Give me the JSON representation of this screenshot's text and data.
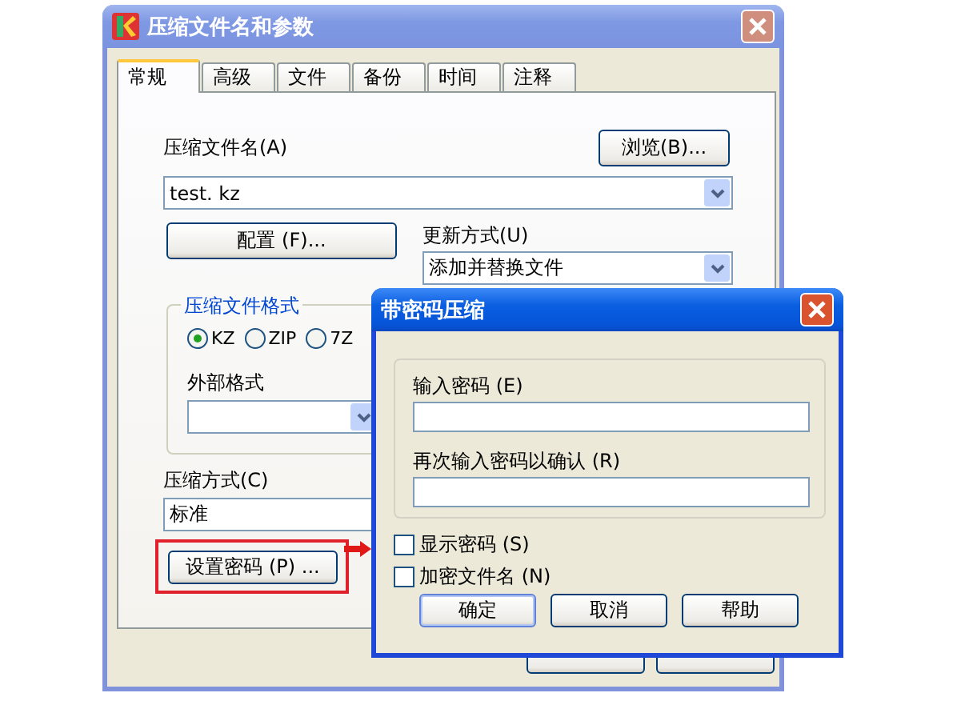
{
  "main_window": {
    "title": "压缩文件名和参数",
    "tabs": [
      {
        "label": "常规",
        "selected": true
      },
      {
        "label": "高级",
        "selected": false
      },
      {
        "label": "文件",
        "selected": false
      },
      {
        "label": "备份",
        "selected": false
      },
      {
        "label": "时间",
        "selected": false
      },
      {
        "label": "注释",
        "selected": false
      }
    ],
    "archive_name": {
      "label": "压缩文件名(A)",
      "value": "test. kz"
    },
    "browse_button": "浏览(B)...",
    "config_button": "配置 (F)...",
    "update_mode": {
      "label": "更新方式(U)",
      "value": "添加并替换文件"
    },
    "format_group": {
      "title": "压缩文件格式",
      "options": [
        {
          "label": "KZ",
          "selected": true
        },
        {
          "label": "ZIP",
          "selected": false
        },
        {
          "label": "7Z",
          "selected": false
        }
      ],
      "external_label": "外部格式"
    },
    "method": {
      "label": "压缩方式(C)",
      "value": "标准"
    },
    "password_button": {
      "label": "设置密码 (P) ...",
      "highlighted": true
    }
  },
  "password_dialog": {
    "title": "带密码压缩",
    "fields": [
      {
        "label": "输入密码 (E)"
      },
      {
        "label": "再次输入密码以确认 (R)"
      }
    ],
    "options": [
      {
        "label": "显示密码 (S)",
        "checked": false
      },
      {
        "label": "加密文件名 (N)",
        "checked": false
      }
    ],
    "buttons": [
      "确定",
      "取消",
      "帮助"
    ]
  }
}
